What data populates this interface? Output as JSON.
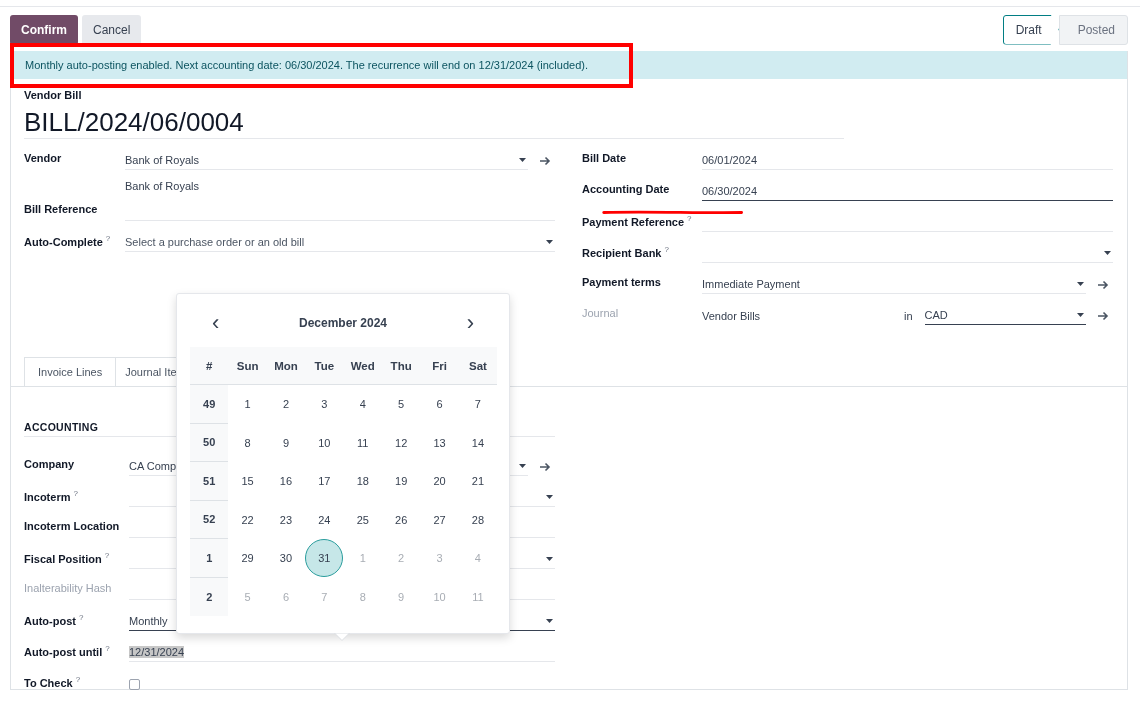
{
  "actions": [
    {
      "label": "Confirm",
      "kind": "primary"
    },
    {
      "label": "Cancel",
      "kind": "secondary"
    }
  ],
  "status_steps": [
    {
      "label": "Draft",
      "selected": true
    },
    {
      "label": "Posted",
      "selected": false
    }
  ],
  "alert": "Monthly auto-posting enabled. Next accounting date: 06/30/2024. The recurrence will end on 12/31/2024 (included).",
  "record": {
    "type_label": "Vendor Bill",
    "name": "BILL/2024/06/0004"
  },
  "left_fields": [
    {
      "label": "Vendor",
      "kind": "link",
      "value": "Bank of Royals",
      "note": "Bank of Royals"
    },
    {
      "label": "Bill Reference",
      "kind": "text"
    },
    {
      "label": "Auto-Complete",
      "help": "?",
      "kind": "select",
      "placeholder": "Select a purchase order or an old bill"
    }
  ],
  "right_fields": [
    {
      "label": "Bill Date",
      "kind": "text",
      "value": "06/01/2024"
    },
    {
      "label": "Accounting Date",
      "kind": "text",
      "value": "06/30/2024",
      "focused": true
    },
    {
      "label": "Payment Reference",
      "help": "?",
      "kind": "text"
    },
    {
      "label": "Recipient Bank",
      "help": "?",
      "kind": "select"
    },
    {
      "label": "Payment terms",
      "kind": "link",
      "value": "Immediate Payment"
    },
    {
      "label": "Journal",
      "kind": "journal",
      "readonly": true,
      "value": "Vendor Bills",
      "connector": "in",
      "currency": {
        "value": "CAD",
        "focused": true
      }
    }
  ],
  "tabs": [
    {
      "label": "Invoice Lines",
      "selected": false
    },
    {
      "label": "Journal Ite",
      "selected": false
    }
  ],
  "accounting": {
    "title": "ACCOUNTING",
    "fields": [
      {
        "label": "Company",
        "kind": "link",
        "value": "CA Comp"
      },
      {
        "label": "Incoterm",
        "help": "?",
        "kind": "select"
      },
      {
        "label": "Incoterm Location",
        "kind": "text"
      },
      {
        "label": "Fiscal Position",
        "help": "?",
        "kind": "select"
      },
      {
        "label": "Inalterability Hash",
        "kind": "text",
        "readonly": true
      },
      {
        "label": "Auto-post",
        "help": "?",
        "kind": "select",
        "value": "Monthly",
        "focused": true
      },
      {
        "label": "Auto-post until",
        "help": "?",
        "kind": "text",
        "value": "12/31/2024",
        "highlighted": true
      },
      {
        "label": "To Check",
        "help": "?",
        "kind": "checkbox",
        "checked": false
      }
    ]
  },
  "datepicker": {
    "prev": "‹",
    "next": "›",
    "month": "December 2024",
    "week_header": "#",
    "weekdays": [
      "Sun",
      "Mon",
      "Tue",
      "Wed",
      "Thu",
      "Fri",
      "Sat"
    ],
    "weeks": [
      {
        "week": "49",
        "days": [
          {
            "day": "1",
            "muted": false,
            "selected": false
          },
          {
            "day": "2",
            "muted": false,
            "selected": false
          },
          {
            "day": "3",
            "muted": false,
            "selected": false
          },
          {
            "day": "4",
            "muted": false,
            "selected": false
          },
          {
            "day": "5",
            "muted": false,
            "selected": false
          },
          {
            "day": "6",
            "muted": false,
            "selected": false
          },
          {
            "day": "7",
            "muted": false,
            "selected": false
          }
        ]
      },
      {
        "week": "50",
        "days": [
          {
            "day": "8",
            "muted": false,
            "selected": false
          },
          {
            "day": "9",
            "muted": false,
            "selected": false
          },
          {
            "day": "10",
            "muted": false,
            "selected": false
          },
          {
            "day": "11",
            "muted": false,
            "selected": false
          },
          {
            "day": "12",
            "muted": false,
            "selected": false
          },
          {
            "day": "13",
            "muted": false,
            "selected": false
          },
          {
            "day": "14",
            "muted": false,
            "selected": false
          }
        ]
      },
      {
        "week": "51",
        "days": [
          {
            "day": "15",
            "muted": false,
            "selected": false
          },
          {
            "day": "16",
            "muted": false,
            "selected": false
          },
          {
            "day": "17",
            "muted": false,
            "selected": false
          },
          {
            "day": "18",
            "muted": false,
            "selected": false
          },
          {
            "day": "19",
            "muted": false,
            "selected": false
          },
          {
            "day": "20",
            "muted": false,
            "selected": false
          },
          {
            "day": "21",
            "muted": false,
            "selected": false
          }
        ]
      },
      {
        "week": "52",
        "days": [
          {
            "day": "22",
            "muted": false,
            "selected": false
          },
          {
            "day": "23",
            "muted": false,
            "selected": false
          },
          {
            "day": "24",
            "muted": false,
            "selected": false
          },
          {
            "day": "25",
            "muted": false,
            "selected": false
          },
          {
            "day": "26",
            "muted": false,
            "selected": false
          },
          {
            "day": "27",
            "muted": false,
            "selected": false
          },
          {
            "day": "28",
            "muted": false,
            "selected": false
          }
        ]
      },
      {
        "week": "1",
        "days": [
          {
            "day": "29",
            "muted": false,
            "selected": false
          },
          {
            "day": "30",
            "muted": false,
            "selected": false
          },
          {
            "day": "31",
            "muted": false,
            "selected": true
          },
          {
            "day": "1",
            "muted": true,
            "selected": false
          },
          {
            "day": "2",
            "muted": true,
            "selected": false
          },
          {
            "day": "3",
            "muted": true,
            "selected": false
          },
          {
            "day": "4",
            "muted": true,
            "selected": false
          }
        ]
      },
      {
        "week": "2",
        "days": [
          {
            "day": "5",
            "muted": true,
            "selected": false
          },
          {
            "day": "6",
            "muted": true,
            "selected": false
          },
          {
            "day": "7",
            "muted": true,
            "selected": false
          },
          {
            "day": "8",
            "muted": true,
            "selected": false
          },
          {
            "day": "9",
            "muted": true,
            "selected": false
          },
          {
            "day": "10",
            "muted": true,
            "selected": false
          },
          {
            "day": "11",
            "muted": true,
            "selected": false
          }
        ]
      }
    ]
  }
}
